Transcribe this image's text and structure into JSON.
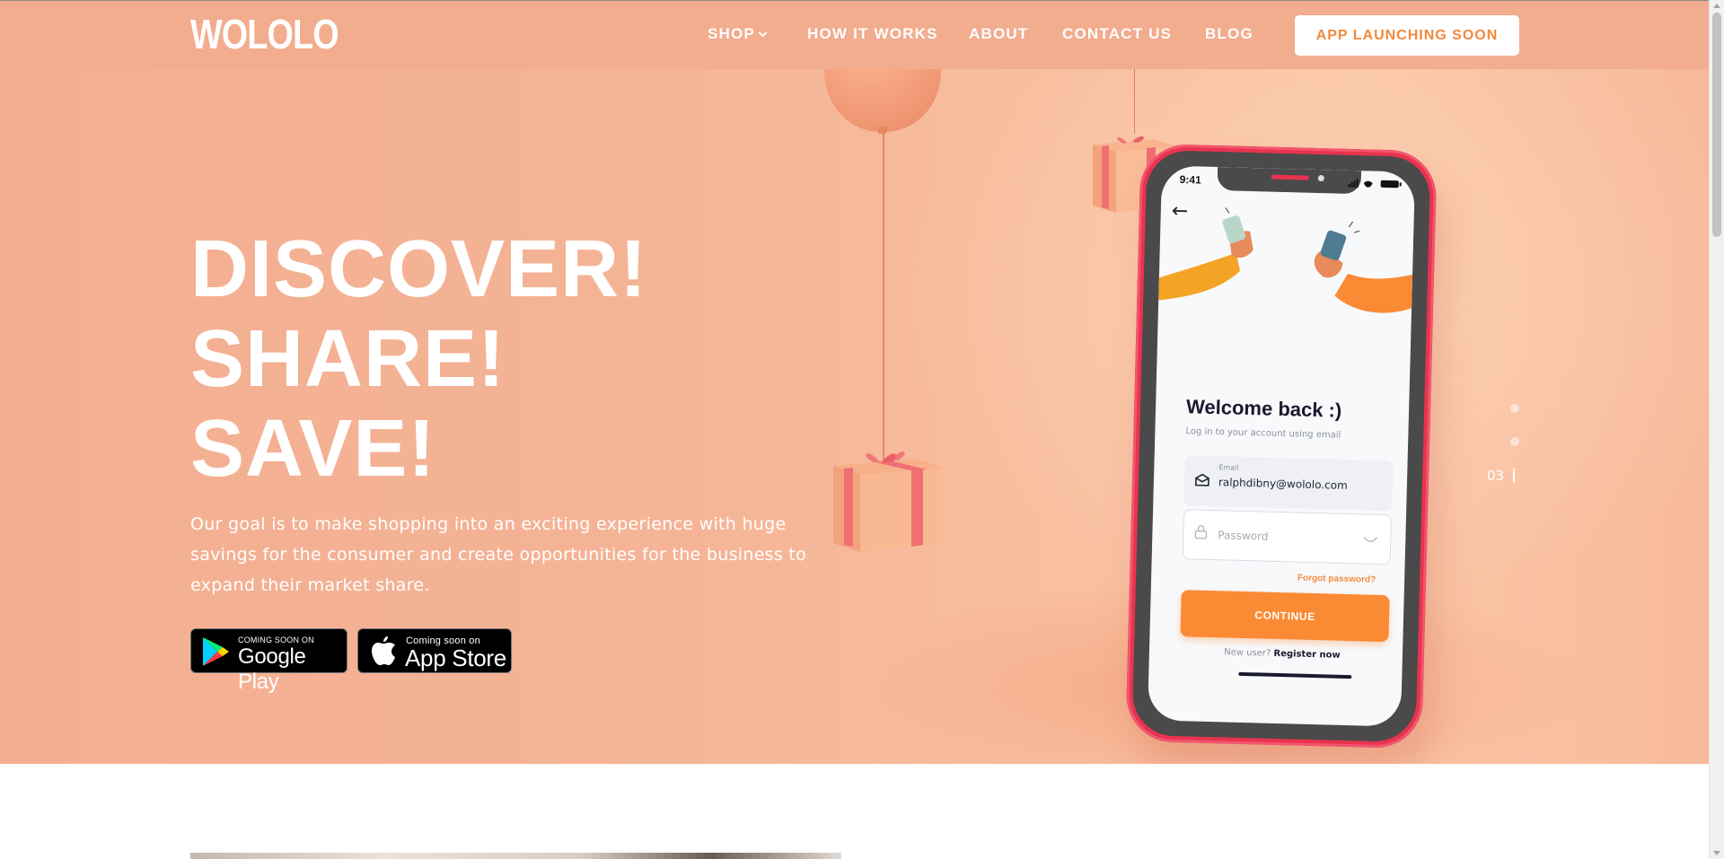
{
  "header": {
    "logo": "WOLOLO",
    "nav": {
      "shop": "SHOP",
      "how_it_works": "HOW IT WORKS",
      "about": "ABOUT",
      "contact": "CONTACT US",
      "blog": "BLOG"
    },
    "cta": "APP LAUNCHING SOON"
  },
  "hero": {
    "headline": [
      "DISCOVER!",
      "SHARE!",
      "SAVE!"
    ],
    "subtext": "Our goal is to make  shopping into an exciting experience with huge savings for the consumer and  create  opportunities for the business to expand their market share.",
    "google_play": {
      "small": "COMING SOON ON",
      "big": "Google Play"
    },
    "app_store": {
      "small": "Coming soon on",
      "big": "App Store"
    }
  },
  "phone": {
    "time": "9:41",
    "welcome": "Welcome back :)",
    "welcome_sub": "Log in to your account using email",
    "email_label": "Email",
    "email_value": "ralphdibny@wololo.com",
    "password_placeholder": "Password",
    "forgot": "Forgot password?",
    "continue": "CONTINUE",
    "new_user": "New user?",
    "register": "Register now"
  },
  "slider": {
    "counter": "03"
  },
  "colors": {
    "header_bg": "#f2ac8e",
    "accent": "#f08a3c",
    "phone_frame": "#e8334f",
    "continue_btn": "#fb8a34"
  }
}
